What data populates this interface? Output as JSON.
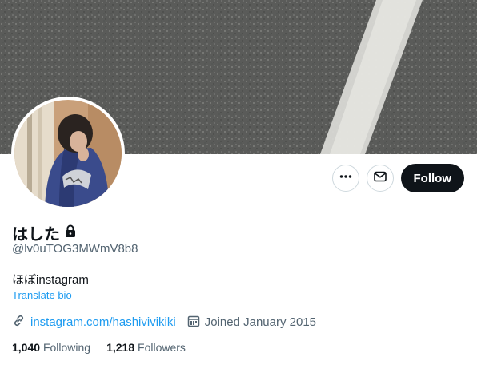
{
  "profile": {
    "display_name": "はした",
    "handle": "@lv0uTOG3MWmV8b8",
    "bio": "ほぼinstagram",
    "translate_label": "Translate bio",
    "link_text": "instagram.com/hashivivikiki",
    "joined_text": "Joined January 2015",
    "following_count": "1,040",
    "following_label": "Following",
    "followers_count": "1,218",
    "followers_label": "Followers"
  },
  "actions": {
    "follow_label": "Follow",
    "more_icon": "more-icon",
    "message_icon": "mail-icon"
  },
  "icons": {
    "lock": "lock-icon",
    "link": "link-icon",
    "calendar": "calendar-icon"
  },
  "colors": {
    "accent": "#1d9bf0",
    "text": "#0f1419",
    "secondary": "#536471",
    "follow_bg": "#0f1419"
  }
}
